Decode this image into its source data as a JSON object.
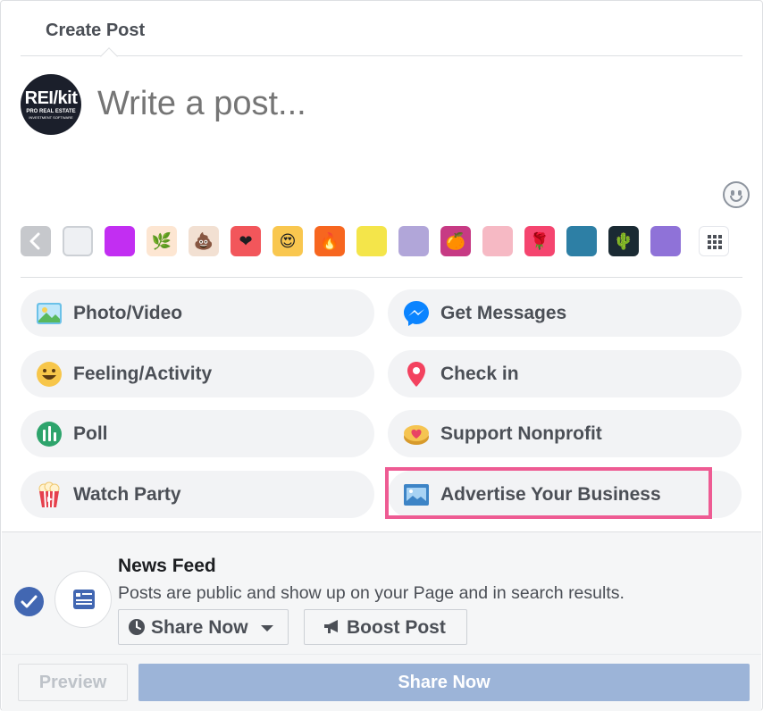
{
  "header": {
    "title": "Create Post"
  },
  "composer": {
    "avatar": {
      "brand": "REI/kit",
      "line1": "PRO REAL ESTATE",
      "line2": "INVESTMENT SOFTWARE"
    },
    "placeholder": "Write a post...",
    "emoji_icon": "smiley-face-icon"
  },
  "backgrounds": {
    "nav_prev_icon": "chevron-left-icon",
    "more_icon": "grid-icon",
    "swatches": [
      {
        "name": "plain-white",
        "color": "#eef0f3",
        "glyph": ""
      },
      {
        "name": "purple",
        "color": "#c22ef2",
        "glyph": ""
      },
      {
        "name": "orange-leaf",
        "color": "#fde6d2",
        "glyph": "🌿"
      },
      {
        "name": "poop-emoji",
        "color": "#f2e0d2",
        "glyph": "💩"
      },
      {
        "name": "red-heart",
        "color": "#f2565b",
        "glyph": "❤"
      },
      {
        "name": "heart-eyes-emoji",
        "color": "#f9c74f",
        "glyph": "😍"
      },
      {
        "name": "fire",
        "color": "#f7661f",
        "glyph": "🔥"
      },
      {
        "name": "yellow-figure",
        "color": "#f4e54a",
        "glyph": ""
      },
      {
        "name": "lavender-cubes",
        "color": "#b1a6d9",
        "glyph": ""
      },
      {
        "name": "orange-fruit",
        "color": "#c73a84",
        "glyph": "🍊"
      },
      {
        "name": "pink-eye",
        "color": "#f6b9c4",
        "glyph": ""
      },
      {
        "name": "rose",
        "color": "#f5456f",
        "glyph": "🌹"
      },
      {
        "name": "blue-wave",
        "color": "#2d7fa5",
        "glyph": ""
      },
      {
        "name": "cactus",
        "color": "#1a2a33",
        "glyph": "🌵"
      },
      {
        "name": "purple-rays",
        "color": "#8f72d8",
        "glyph": ""
      }
    ]
  },
  "actions": [
    {
      "label": "Photo/Video",
      "icon": "photo-video-icon"
    },
    {
      "label": "Get Messages",
      "icon": "messenger-icon"
    },
    {
      "label": "Feeling/Activity",
      "icon": "smiley-icon"
    },
    {
      "label": "Check in",
      "icon": "location-pin-icon"
    },
    {
      "label": "Poll",
      "icon": "poll-icon"
    },
    {
      "label": "Support Nonprofit",
      "icon": "nonprofit-heart-icon"
    },
    {
      "label": "Watch Party",
      "icon": "popcorn-icon"
    },
    {
      "label": "Advertise Your Business",
      "icon": "advertise-icon"
    }
  ],
  "audience": {
    "title": "News Feed",
    "description": "Posts are public and show up on your Page and in search results.",
    "share_now_label": "Share Now",
    "boost_label": "Boost Post"
  },
  "footer": {
    "preview_label": "Preview",
    "share_label": "Share Now"
  },
  "colors": {
    "accent": "#4267b2",
    "share_button": "#9cb4d8",
    "highlight": "#ee5b93",
    "pill_bg": "#f2f3f5"
  }
}
